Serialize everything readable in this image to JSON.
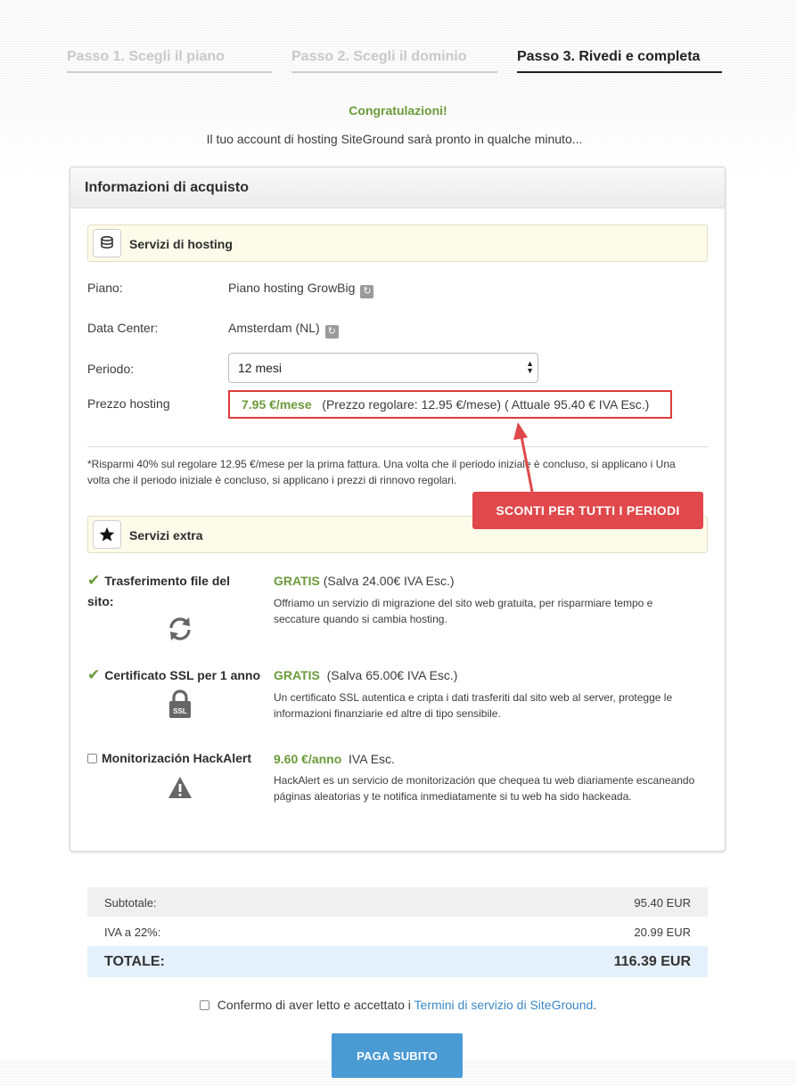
{
  "steps": [
    {
      "label": "Passo 1. Scegli il piano",
      "active": false
    },
    {
      "label": "Passo 2. Scegli il dominio",
      "active": false
    },
    {
      "label": "Passo 3. Rivedi e completa",
      "active": true
    }
  ],
  "header": {
    "congrats": "Congratulazioni!",
    "subtitle": "Il tuo account di hosting SiteGround sarà pronto in qualche minuto..."
  },
  "panel": {
    "title": "Informazioni di acquisto",
    "hosting_section": "Servizi di hosting",
    "rows": {
      "plan_label": "Piano:",
      "plan_value": "Piano hosting GrowBig",
      "dc_label": "Data Center:",
      "dc_value": "Amsterdam (NL)",
      "period_label": "Periodo:",
      "period_value": "12 mesi",
      "price_label": "Prezzo hosting"
    },
    "price": {
      "main": "7.95 €/mese",
      "regular": "(Prezzo regolare: 12.95 €/mese)",
      "current": "( Attuale  95.40 € IVA Esc.)"
    },
    "note": "*Risparmi 40% sul regolare 12.95 €/mese per la prima fattura. Una volta che il periodo iniziale è concluso, si applicano i Una volta che il periodo iniziale è concluso, si applicano i prezzi di rinnovo regolari.",
    "callout": "SCONTI PER TUTTI I PERIODI",
    "extra_section": "Servizi extra",
    "extras": [
      {
        "title_line1": "Trasferimento file del",
        "title_line2": "sito:",
        "price": "GRATIS",
        "price_note": "(Salva 24.00€ IVA Esc.)",
        "desc": "Offriamo un servizio di migrazione del sito web gratuita, per risparmiare tempo e seccature quando si cambia hosting.",
        "icon": "refresh-icon"
      },
      {
        "title_line1": "Certificato SSL per 1 anno",
        "price": "GRATIS",
        "price_note": "(Salva 65.00€ IVA Esc.)",
        "desc": "Un certificato SSL autentica e cripta i dati trasferiti dal sito web al server, protegge le informazioni finanziarie ed altre di tipo sensibile.",
        "icon": "ssl-lock-icon",
        "icon_text": "SSL"
      },
      {
        "title_line1": "Monitorización HackAlert",
        "price": "9.60 €/anno",
        "price_note": "IVA Esc.",
        "desc": "HackAlert es un servicio de monitorización que chequea tu web diariamente escaneando páginas aleatorias y te notifica inmediatamente si tu web ha sido hackeada.",
        "icon": "warning-icon"
      }
    ]
  },
  "totals": {
    "subtotal_label": "Subtotale:",
    "subtotal_value": "95.40 EUR",
    "vat_label": "IVA a 22%:",
    "vat_value": "20.99 EUR",
    "total_label": "TOTALE:",
    "total_value": "116.39 EUR"
  },
  "terms": {
    "text": "Confermo di aver letto e accettato i ",
    "link": "Termini di servizio di SiteGround",
    "suffix": "."
  },
  "pay_button": "PAGA SUBITO",
  "colors": {
    "accent_green": "#6b9a3a",
    "callout_red": "#e0484b",
    "button_blue": "#4a9ad4",
    "link_blue": "#3b87c4"
  }
}
